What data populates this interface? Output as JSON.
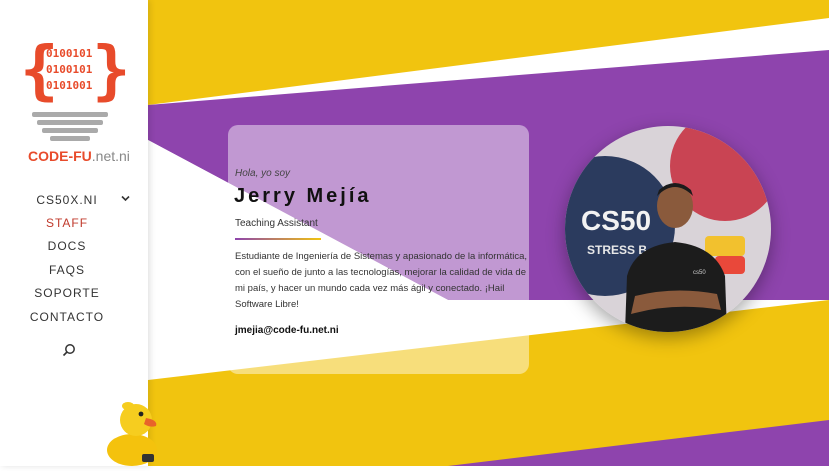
{
  "logo": {
    "binary_lines": [
      "0100101",
      "0100101",
      "0101001"
    ],
    "brace_left": "{",
    "brace_right": "}",
    "brand_primary": "CODE-FU",
    "brand_secondary": ".net.ni"
  },
  "nav": {
    "items": [
      {
        "label": "CS50X.NI",
        "has_submenu": true
      },
      {
        "label": "STAFF",
        "active": true
      },
      {
        "label": "DOCS"
      },
      {
        "label": "FAQS"
      },
      {
        "label": "SOPORTE"
      },
      {
        "label": "CONTACTO"
      }
    ],
    "search_icon": "search-icon",
    "submenu_icon": "chevron-down-icon"
  },
  "profile": {
    "greeting": "Hola, yo soy",
    "name": "Jerry Mejía",
    "role": "Teaching Assistant",
    "bio": "Estudiante de Ingeniería de Sistemas y apasionado de la informática, con el sueño de junto a las tecnologías, mejorar la calidad de vida de mi país, y hacer un mundo cada vez más ágil y conectado. ¡Hail Software Libre!",
    "email": "jmejia@code-fu.net.ni"
  },
  "photo_text": {
    "ball_line1": "CS50",
    "ball_line2": "STRESS B",
    "shirt_logo": "cs50"
  },
  "colors": {
    "yellow": "#f1c40f",
    "purple": "#8e44ad",
    "brand_red": "#e84b2b",
    "active_nav": "#c0392b"
  }
}
